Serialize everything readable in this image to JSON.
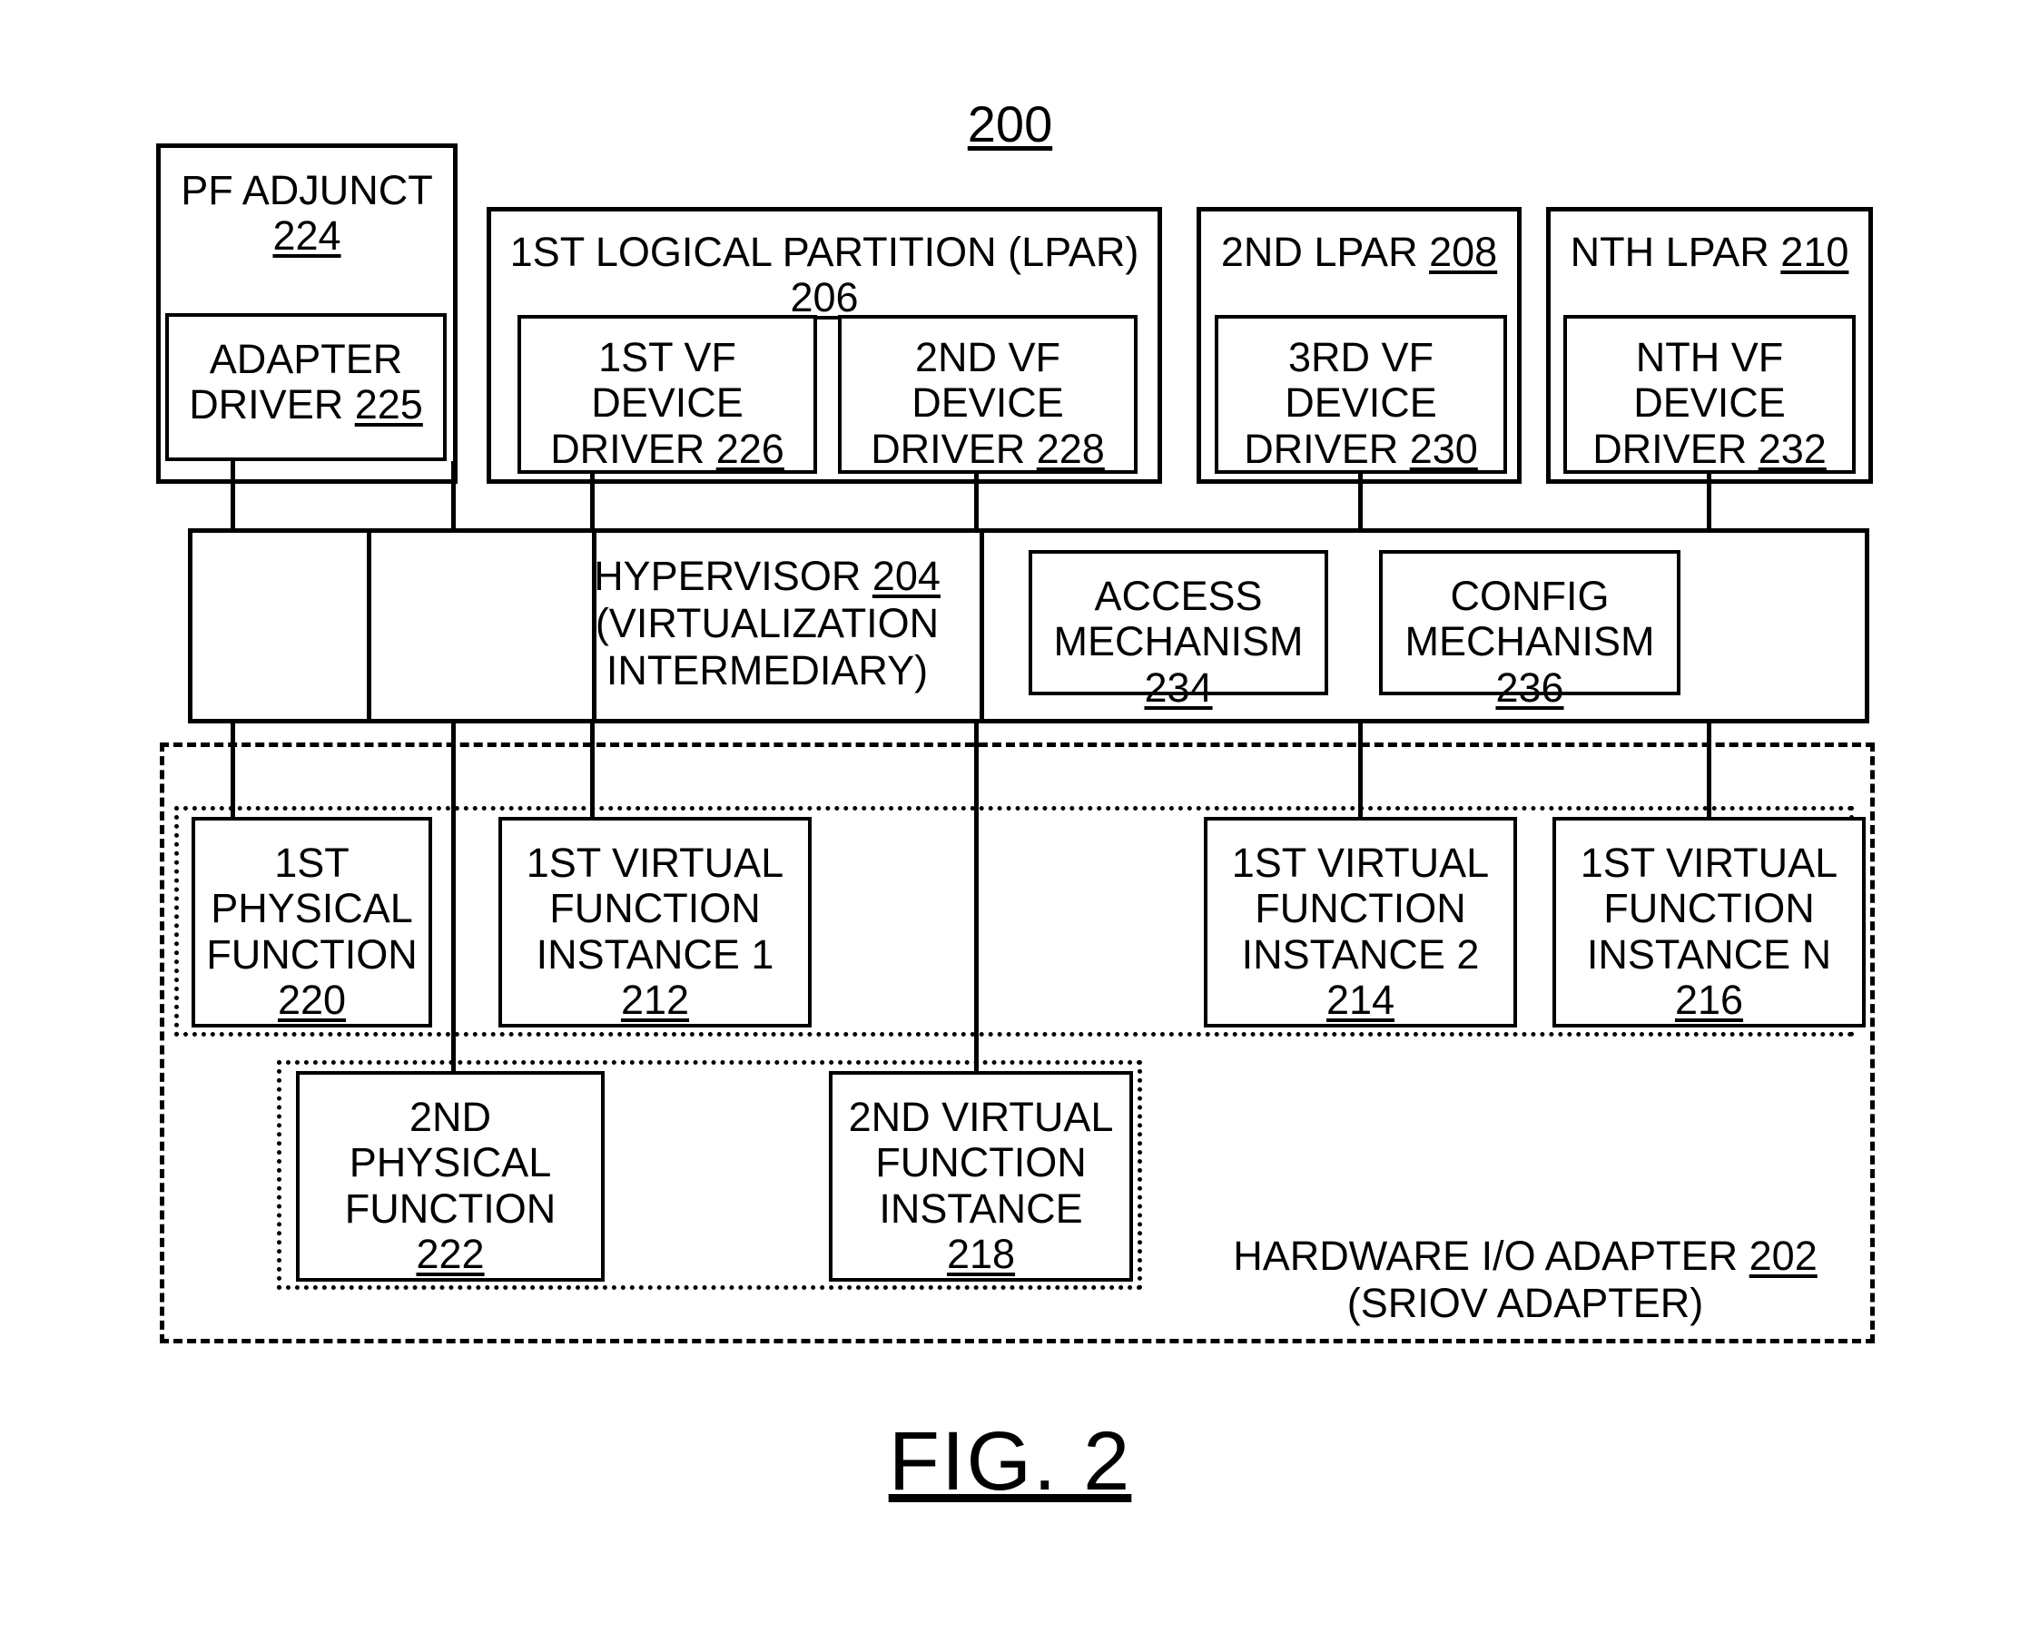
{
  "figure": {
    "number": "200",
    "caption": "FIG. 2"
  },
  "pf_adjunct": {
    "title": "PF ADJUNCT",
    "ref": "224",
    "adapter_driver": {
      "line1": "ADAPTER",
      "line2": "DRIVER ",
      "ref": "225"
    }
  },
  "lpars": [
    {
      "title": "1ST LOGICAL PARTITION (LPAR)",
      "ref": "206",
      "drivers": [
        {
          "line1": "1ST VF",
          "line2": "DEVICE",
          "line3": "DRIVER ",
          "ref": "226"
        },
        {
          "line1": "2ND VF",
          "line2": "DEVICE",
          "line3": "DRIVER ",
          "ref": "228"
        }
      ]
    },
    {
      "title": "2ND LPAR ",
      "ref": "208",
      "drivers": [
        {
          "line1": "3RD VF",
          "line2": "DEVICE",
          "line3": "DRIVER ",
          "ref": "230"
        }
      ]
    },
    {
      "title": "NTH LPAR ",
      "ref": "210",
      "drivers": [
        {
          "line1": "NTH VF",
          "line2": "DEVICE",
          "line3": "DRIVER ",
          "ref": "232"
        }
      ]
    }
  ],
  "hypervisor": {
    "line1": "HYPERVISOR ",
    "ref": "204",
    "line2": "(VIRTUALIZATION",
    "line3": "INTERMEDIARY)",
    "access_mechanism": {
      "line1": "ACCESS",
      "line2": "MECHANISM",
      "ref": "234"
    },
    "config_mechanism": {
      "line1": "CONFIG",
      "line2": "MECHANISM",
      "ref": "236"
    }
  },
  "hardware_adapter": {
    "label_line1": "HARDWARE I/O ADAPTER ",
    "ref": "202",
    "label_line2": "(SRIOV ADAPTER)",
    "functions": [
      {
        "line1": "1ST",
        "line2": "PHYSICAL",
        "line3": "FUNCTION",
        "ref": "220"
      },
      {
        "line1": "1ST VIRTUAL",
        "line2": "FUNCTION",
        "line3": "INSTANCE 1",
        "ref": "212"
      },
      {
        "line1": "1ST VIRTUAL",
        "line2": "FUNCTION",
        "line3": "INSTANCE 2",
        "ref": "214"
      },
      {
        "line1": "1ST VIRTUAL",
        "line2": "FUNCTION",
        "line3": "INSTANCE N",
        "ref": "216"
      },
      {
        "line1": "2ND",
        "line2": "PHYSICAL",
        "line3": "FUNCTION",
        "ref": "222"
      },
      {
        "line1": "2ND VIRTUAL",
        "line2": "FUNCTION",
        "line3": "INSTANCE",
        "ref": "218"
      }
    ]
  },
  "colors": {
    "stroke": "#000000",
    "background": "#ffffff"
  }
}
